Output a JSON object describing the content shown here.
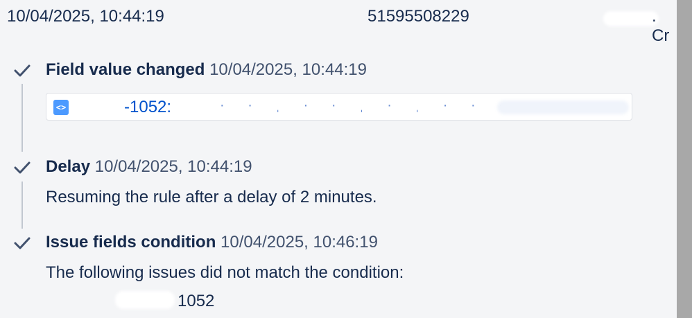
{
  "header": {
    "timestamp": "10/04/2025, 10:44:19",
    "id": "51595508229",
    "trailing": ". Cr"
  },
  "steps": [
    {
      "title": "Field value changed",
      "time": "10/04/2025, 10:44:19",
      "card": {
        "icon": "<>",
        "key": "-1052:"
      }
    },
    {
      "title": "Delay",
      "time": "10/04/2025, 10:44:19",
      "text": "Resuming the rule after a delay of 2 minutes."
    },
    {
      "title": "Issue fields condition",
      "time": "10/04/2025, 10:46:19",
      "text": "The following issues did not match the condition:",
      "issue": "1052"
    }
  ],
  "icons": {
    "step_status": "check-icon",
    "card_icon": "code-icon"
  },
  "colors": {
    "background": "#f4f5f7",
    "text": "#172b4d",
    "link": "#0052cc",
    "icon_accent": "#4c9aff"
  }
}
